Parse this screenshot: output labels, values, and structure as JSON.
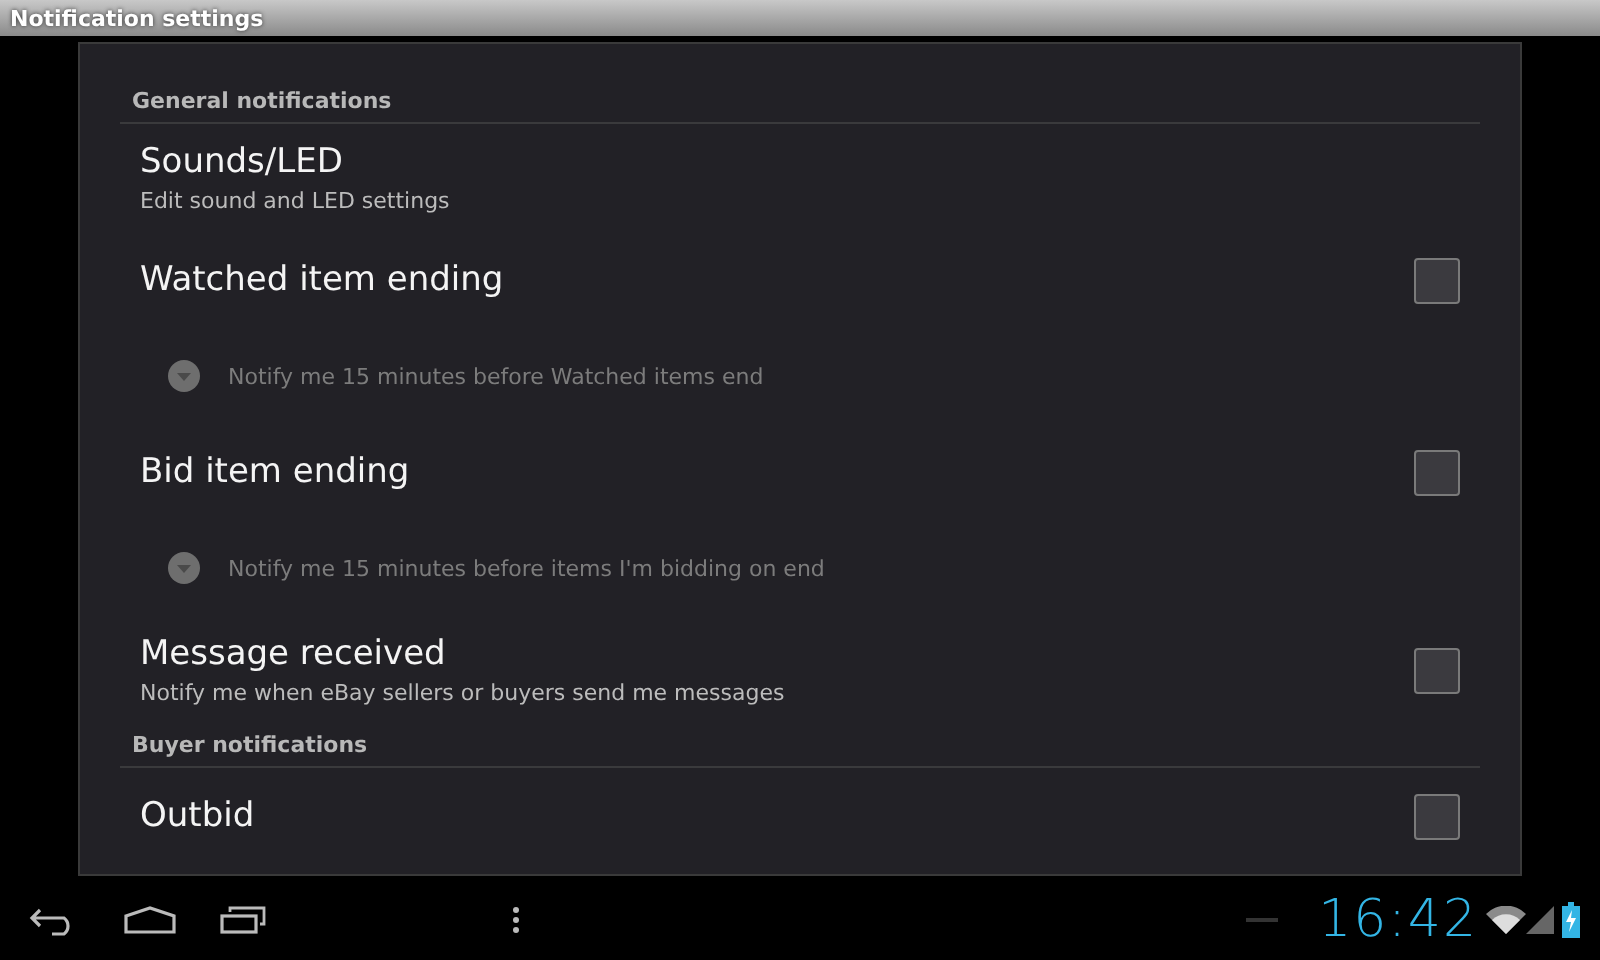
{
  "window": {
    "title": "Notification settings"
  },
  "items": [
    {
      "kind": "header",
      "label": "General notifications"
    },
    {
      "kind": "pref",
      "title": "Sounds/LED",
      "summary": "Edit sound and LED settings"
    },
    {
      "kind": "pref",
      "title": "Watched item ending",
      "checkbox": true,
      "checked": false
    },
    {
      "kind": "dependent",
      "label": "Notify me 15 minutes before Watched items end",
      "disabled": true
    },
    {
      "kind": "pref",
      "title": "Bid item ending",
      "checkbox": true,
      "checked": false
    },
    {
      "kind": "dependent",
      "label": "Notify me 15 minutes before items I'm bidding on end",
      "disabled": true
    },
    {
      "kind": "pref",
      "title": "Message received",
      "summary": "Notify me when eBay sellers or buyers send me messages",
      "checkbox": true,
      "checked": false
    },
    {
      "kind": "header",
      "label": "Buyer notifications"
    },
    {
      "kind": "pref",
      "title": "Outbid",
      "checkbox": true,
      "checked": false
    }
  ],
  "status_bar": {
    "time": "16:42"
  }
}
